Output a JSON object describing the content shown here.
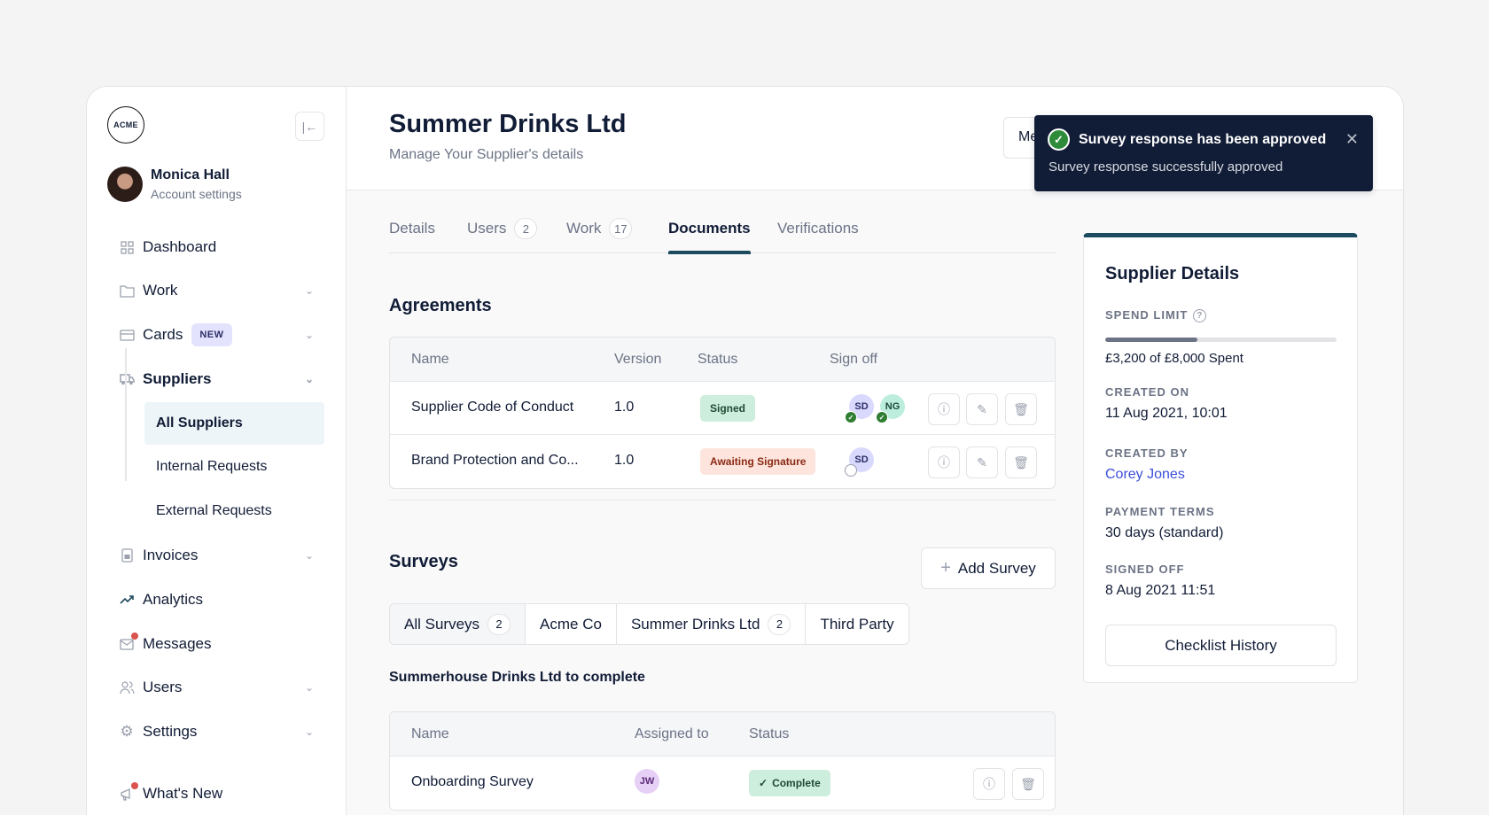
{
  "sidebar": {
    "logo": "ACME",
    "user": {
      "name": "Monica Hall",
      "subtitle": "Account settings"
    },
    "items": [
      {
        "label": "Dashboard",
        "icon": "grid-icon"
      },
      {
        "label": "Work",
        "icon": "folder-icon",
        "expandable": true
      },
      {
        "label": "Cards",
        "icon": "card-icon",
        "badge": "NEW",
        "expandable": true
      },
      {
        "label": "Suppliers",
        "icon": "truck-icon",
        "expandable": true,
        "active": true
      },
      {
        "label": "Invoices",
        "icon": "calculator-icon",
        "expandable": true
      },
      {
        "label": "Analytics",
        "icon": "trend-icon"
      },
      {
        "label": "Messages",
        "icon": "mail-icon",
        "notification": true
      },
      {
        "label": "Users",
        "icon": "users-icon",
        "expandable": true
      },
      {
        "label": "Settings",
        "icon": "gear-icon",
        "expandable": true
      }
    ],
    "sub_items": [
      {
        "label": "All Suppliers",
        "active": true
      },
      {
        "label": "Internal Requests"
      },
      {
        "label": "External Requests"
      }
    ],
    "whats_new": "What's New"
  },
  "header": {
    "title": "Summer Drinks Ltd",
    "subtitle": "Manage Your Supplier's details",
    "button_label": "Me"
  },
  "toast": {
    "title": "Survey response has been approved",
    "message": "Survey response successfully approved"
  },
  "tabs": [
    {
      "label": "Details"
    },
    {
      "label": "Users",
      "count": "2"
    },
    {
      "label": "Work",
      "count": "17"
    },
    {
      "label": "Documents",
      "active": true
    },
    {
      "label": "Verifications"
    }
  ],
  "agreements": {
    "title": "Agreements",
    "columns": [
      "Name",
      "Version",
      "Status",
      "Sign off"
    ],
    "rows": [
      {
        "name": "Supplier Code of Conduct",
        "version": "1.0",
        "status": "Signed",
        "signoff": [
          "SD",
          "NG"
        ]
      },
      {
        "name": "Brand Protection and Co...",
        "version": "1.0",
        "status": "Awaiting Signature",
        "signoff": [
          "SD"
        ]
      }
    ]
  },
  "surveys": {
    "title": "Surveys",
    "add_label": "Add Survey",
    "filters": [
      {
        "label": "All Surveys",
        "count": "2",
        "active": true
      },
      {
        "label": "Acme Co"
      },
      {
        "label": "Summer Drinks Ltd",
        "count": "2"
      },
      {
        "label": "Third Party"
      }
    ],
    "subheading": "Summerhouse Drinks Ltd to complete",
    "columns": [
      "Name",
      "Assigned to",
      "Status"
    ],
    "rows": [
      {
        "name": "Onboarding Survey",
        "assigned": "JW",
        "status": "Complete"
      }
    ]
  },
  "supplier_details": {
    "title": "Supplier Details",
    "spend_limit_label": "SPEND LIMIT",
    "spend_fraction": 0.4,
    "spend_text": "£3,200 of £8,000 Spent",
    "created_on_label": "CREATED ON",
    "created_on": "11 Aug 2021, 10:01",
    "created_by_label": "CREATED BY",
    "created_by": "Corey Jones",
    "payment_terms_label": "PAYMENT TERMS",
    "payment_terms": "30 days (standard)",
    "signed_off_label": "SIGNED OFF",
    "signed_off": "8 Aug 2021 11:51",
    "button_label": "Checklist History"
  }
}
